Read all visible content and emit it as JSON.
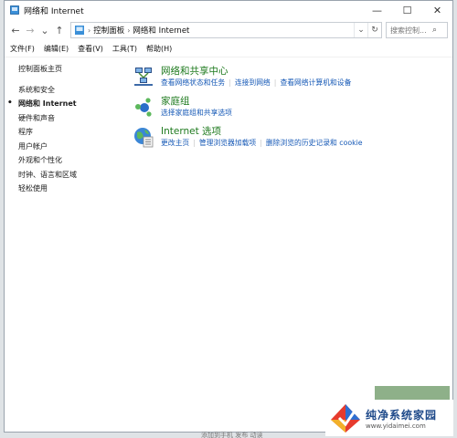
{
  "window": {
    "title": "网络和 Internet"
  },
  "titlebar": {
    "min": "—",
    "max": "☐",
    "close": "✕"
  },
  "nav": {
    "back": "←",
    "forward": "→",
    "dropdown": "⌄",
    "up": "↑",
    "breadcrumbs": [
      "控制面板",
      "网络和 Internet"
    ],
    "crumb_sep": "›",
    "refresh": "↻"
  },
  "search": {
    "placeholder": "搜索控制...",
    "icon": "⌕"
  },
  "menubar": [
    "文件(F)",
    "编辑(E)",
    "查看(V)",
    "工具(T)",
    "帮助(H)"
  ],
  "sidebar": {
    "home": "控制面板主页",
    "items": [
      "系统和安全",
      "网络和 Internet",
      "硬件和声音",
      "程序",
      "用户帐户",
      "外观和个性化",
      "时钟、语言和区域",
      "轻松使用"
    ],
    "active_bullet": "•"
  },
  "categories": [
    {
      "title": "网络和共享中心",
      "links": [
        "查看网络状态和任务",
        "连接到网络",
        "查看网络计算机和设备"
      ],
      "icon": "network-sharing-icon"
    },
    {
      "title": "家庭组",
      "links": [
        "选择家庭组和共享选项"
      ],
      "icon": "homegroup-icon"
    },
    {
      "title": "Internet 选项",
      "links": [
        "更改主页",
        "管理浏览器加载项",
        "删除浏览的历史记录和 cookie"
      ],
      "icon": "internet-options-icon"
    }
  ],
  "taskbar_text": "添加到手机   发布   动读",
  "watermark": {
    "name": "纯净系统家园",
    "url": "www.yidaimei.com"
  },
  "colors": {
    "link": "#1558b6",
    "category_title": "#1e7a1e",
    "background": "#dfe3e6"
  }
}
